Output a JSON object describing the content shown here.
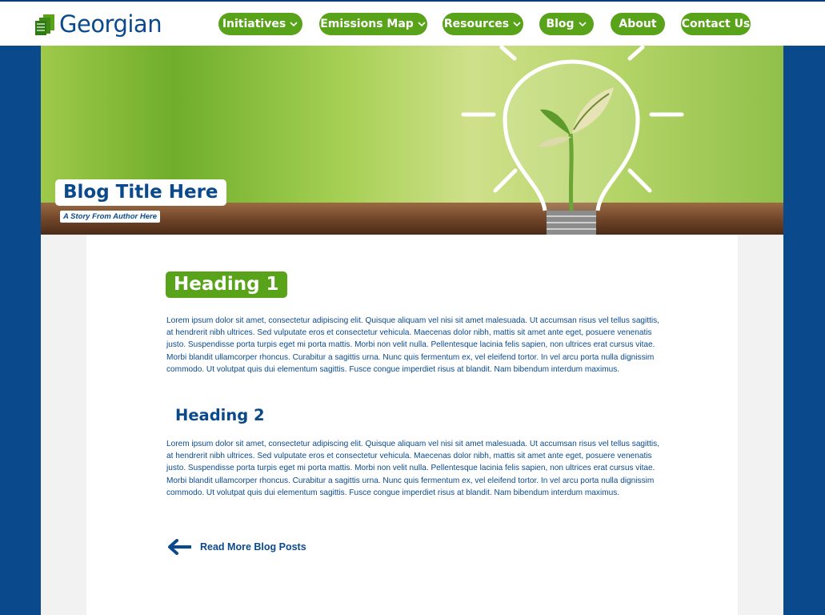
{
  "brand": {
    "name": "Georgian",
    "primary_color": "#0a4a8c",
    "accent_color": "#59a31a"
  },
  "nav": {
    "items": [
      {
        "label": "Initiatives",
        "dropdown": true
      },
      {
        "label": "Emissions Map",
        "dropdown": true
      },
      {
        "label": "Resources",
        "dropdown": true
      },
      {
        "label": "Blog",
        "dropdown": true
      },
      {
        "label": "About",
        "dropdown": false
      },
      {
        "label": "Contact Us",
        "dropdown": false
      }
    ]
  },
  "hero": {
    "title": "Blog Title Here",
    "subtitle": "A Story From Author Here",
    "image": "lightbulb-with-seedling"
  },
  "article": {
    "heading1": "Heading 1",
    "paragraph1": "Lorem ipsum dolor sit amet, consectetur adipiscing elit. Quisque aliquam vel nisi sit amet malesuada. Ut accumsan risus vel tellus sagittis, at hendrerit nibh ultrices. Sed vulputate eros et consectetur vehicula. Maecenas dolor nibh, mattis sit amet ante eget, posuere venenatis justo. Suspendisse porta turpis eget mi porta mattis. Morbi non velit nulla. Pellentesque lacinia felis sapien, non ultrices erat cursus vitae. Morbi blandit ullamcorper rhoncus. Curabitur a sagittis urna. Nunc quis fermentum ex, vel eleifend tortor. In vel arcu porta nulla dignissim commodo. Ut volutpat quis dui elementum sagittis. Fusce congue imperdiet risus at blandit. Nam bibendum interdum maximus.",
    "heading2": "Heading 2",
    "paragraph2": "Lorem ipsum dolor sit amet, consectetur adipiscing elit. Quisque aliquam vel nisi sit amet malesuada. Ut accumsan risus vel tellus sagittis, at hendrerit nibh ultrices. Sed vulputate eros et consectetur vehicula. Maecenas dolor nibh, mattis sit amet ante eget, posuere venenatis justo. Suspendisse porta turpis eget mi porta mattis. Morbi non velit nulla. Pellentesque lacinia felis sapien, non ultrices erat cursus vitae. Morbi blandit ullamcorper rhoncus. Curabitur a sagittis urna. Nunc quis fermentum ex, vel eleifend tortor. In vel arcu porta nulla dignissim commodo. Ut volutpat quis dui elementum sagittis. Fusce congue imperdiet risus at blandit. Nam bibendum interdum maximus.",
    "read_more": "Read More Blog Posts",
    "read_more_icon": "arrow-left-icon"
  }
}
